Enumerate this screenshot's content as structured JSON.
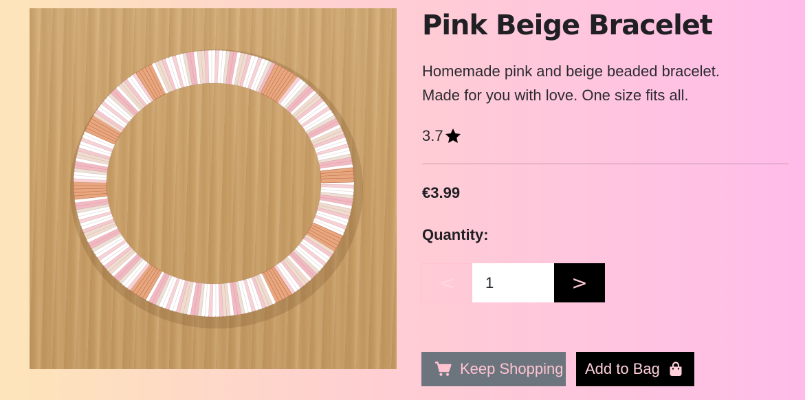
{
  "product": {
    "title": "Pink Beige Bracelet",
    "description_line1": "Homemade pink and beige beaded bracelet.",
    "description_line2": "Made for you with love. One size fits all.",
    "rating": "3.7",
    "rating_icon": "star-icon",
    "price": "€3.99",
    "image_alt": "Pink Beige Bracelet"
  },
  "quantity": {
    "label": "Quantity:",
    "value": "1",
    "decrement_label": "<",
    "increment_label": ">"
  },
  "actions": {
    "keep_shopping_label": "Keep Shopping",
    "keep_shopping_icon": "shopping-cart-icon",
    "add_to_bag_label": "Add to Bag",
    "add_to_bag_icon": "shopping-bag-icon"
  },
  "colors": {
    "accent_pink": "#ffc8d6",
    "button_dark": "#000000",
    "button_secondary": "#6c757d"
  }
}
